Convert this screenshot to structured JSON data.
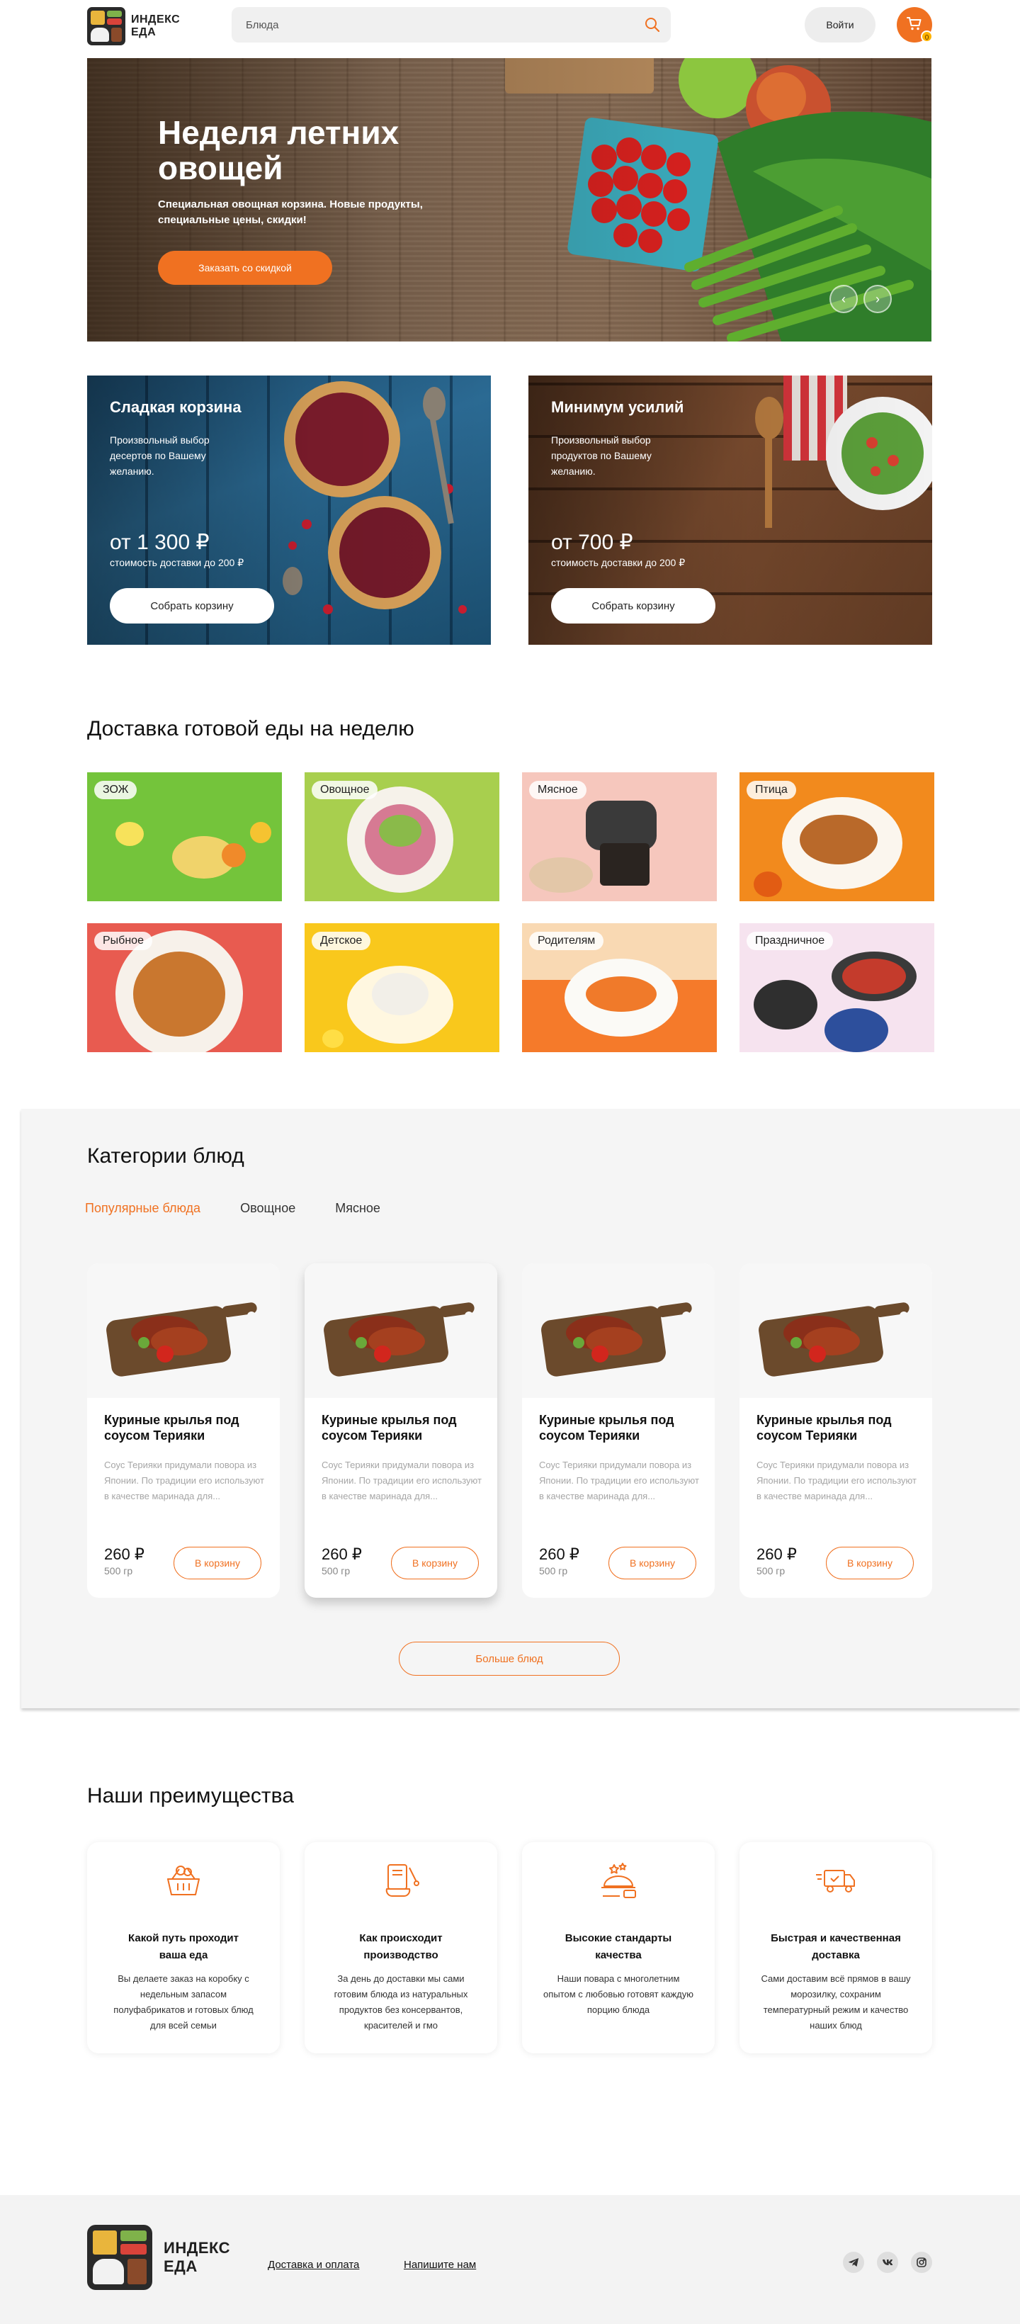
{
  "header": {
    "logo_line1": "ИНДЕКС",
    "logo_line2": "ЕДА",
    "search_placeholder": "Блюда",
    "login_label": "Войти",
    "cart_count": "0"
  },
  "hero": {
    "title": "Неделя летних овощей",
    "subtitle": "Специальная овощная корзина. Новые продукты, специальные цены, скидки!",
    "cta_label": "Заказать со скидкой",
    "prev_arrow": "‹",
    "next_arrow": "›"
  },
  "promos": [
    {
      "title": "Сладкая корзина",
      "description": "Произвольный выбор десертов по Вашему желанию.",
      "price": "от 1 300 ₽",
      "note": "стоимость доставки до 200 ₽",
      "button": "Собрать корзину"
    },
    {
      "title": "Минимум усилий",
      "description": "Произвольный выбор продуктов по Вашему желанию.",
      "price": "от 700 ₽",
      "note": "стоимость доставки до 200 ₽",
      "button": "Собрать корзину"
    }
  ],
  "weekly": {
    "title": "Доставка готовой еды на неделю",
    "tiles": [
      {
        "label": "ЗОЖ",
        "bg": "#74c43b"
      },
      {
        "label": "Овощное",
        "bg": "#a8cf4e"
      },
      {
        "label": "Мясное",
        "bg": "#f6c7bd"
      },
      {
        "label": "Птица",
        "bg": "#f28a1d"
      },
      {
        "label": "Рыбное",
        "bg": "#e85b50"
      },
      {
        "label": "Детское",
        "bg": "#f9c81c"
      },
      {
        "label": "Родителям",
        "bg": "#f9d9b3"
      },
      {
        "label": "Праздничное",
        "bg": "#f6e3ef"
      }
    ]
  },
  "categories": {
    "title": "Категории блюд",
    "tabs": [
      "Популярные блюда",
      "Овощное",
      "Мясное"
    ],
    "dishes": [
      {
        "name": "Куриные крылья под соусом Терияки",
        "description": "Соус Терияки придумали повора из Японии. По традиции его используют в качестве маринада для...",
        "price": "260 ₽",
        "weight": "500 гр",
        "button": "В корзину"
      },
      {
        "name": "Куриные крылья под соусом Терияки",
        "description": "Соус Терияки придумали повора из Японии. По традиции его используют в качестве маринада для...",
        "price": "260 ₽",
        "weight": "500 гр",
        "button": "В корзину"
      },
      {
        "name": "Куриные крылья под соусом Терияки",
        "description": "Соус Терияки придумали повора из Японии. По традиции его используют в качестве маринада для...",
        "price": "260 ₽",
        "weight": "500 гр",
        "button": "В корзину"
      },
      {
        "name": "Куриные крылья под соусом Терияки",
        "description": "Соус Терияки придумали повора из Японии. По традиции его используют в качестве маринада для...",
        "price": "260 ₽",
        "weight": "500 гр",
        "button": "В корзину"
      }
    ],
    "more_label": "Больше блюд"
  },
  "advantages": {
    "title": "Наши преимущества",
    "items": [
      {
        "icon": "basket-icon",
        "title": "Какой путь проходит ваша еда",
        "description": "Вы делаете заказ на коробку с недельным запасом полуфабрикатов и готовых блюд для всей семьи"
      },
      {
        "icon": "cooking-icon",
        "title": "Как происходит производство",
        "description": "За день до доставки мы сами готовим блюда из натуральных продуктов без консервантов, красителей и гмо"
      },
      {
        "icon": "chef-quality-icon",
        "title": "Высокие стандарты качества",
        "description": "Наши повара с многолетним опытом с любовью готовят каждую порцию блюда"
      },
      {
        "icon": "delivery-truck-icon",
        "title": "Быстрая и качественная доставка",
        "description": "Сами доставим всё прямов в вашу морозилку, сохраним температурный режим и качество наших блюд"
      }
    ]
  },
  "footer": {
    "logo_line1": "ИНДЕКС",
    "logo_line2": "ЕДА",
    "links": [
      "Доставка и оплата",
      "Напишите нам"
    ],
    "socials": [
      "telegram-icon",
      "vk-icon",
      "instagram-icon"
    ]
  },
  "colors": {
    "accent": "#f07121",
    "section_bg": "#f5f5f5",
    "footer_bg": "#f3f3f3"
  }
}
